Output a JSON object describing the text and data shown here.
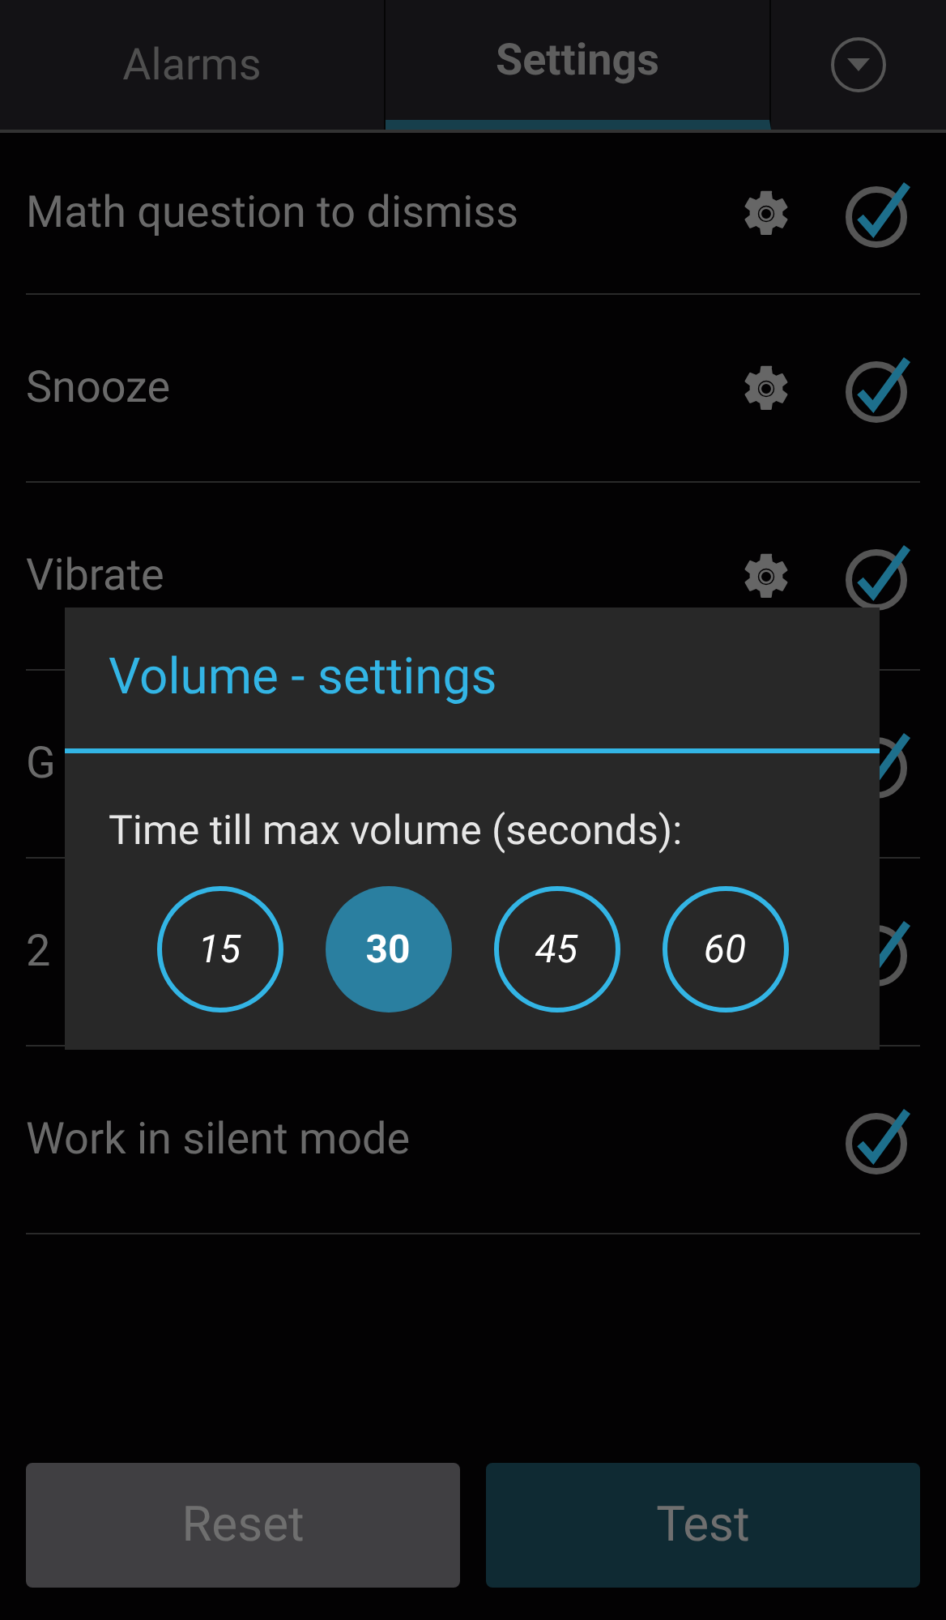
{
  "tabs": [
    {
      "label": "Alarms",
      "selected": false
    },
    {
      "label": "Settings",
      "selected": true
    }
  ],
  "settings": [
    {
      "label": "Math question to dismiss",
      "gear": true,
      "checked": true
    },
    {
      "label": "Snooze",
      "gear": true,
      "checked": true
    },
    {
      "label": "Vibrate",
      "gear": true,
      "checked": true
    },
    {
      "label": "G",
      "gear": false,
      "checked": true
    },
    {
      "label": "2",
      "gear": false,
      "checked": true
    },
    {
      "label": "Work in silent mode",
      "gear": false,
      "checked": true
    }
  ],
  "dialog": {
    "title": "Volume - settings",
    "prompt": "Time till max volume (seconds):",
    "options": [
      {
        "label": "15",
        "selected": false
      },
      {
        "label": "30",
        "selected": true
      },
      {
        "label": "45",
        "selected": false
      },
      {
        "label": "60",
        "selected": false
      }
    ]
  },
  "buttons": [
    {
      "label": "Reset",
      "kind": "neutral"
    },
    {
      "label": "Test",
      "kind": "accent"
    }
  ]
}
